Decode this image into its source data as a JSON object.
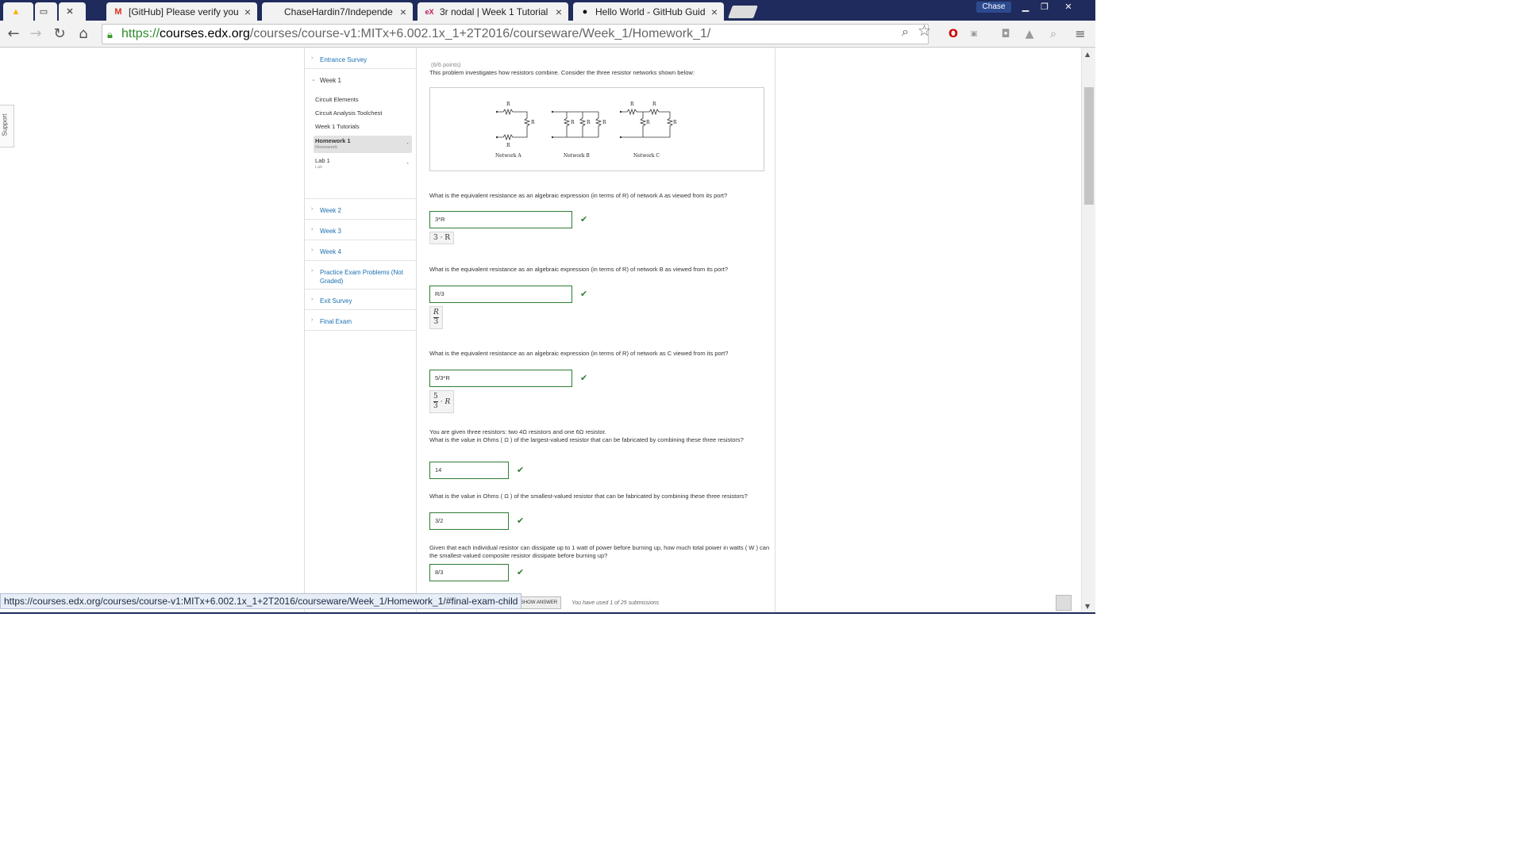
{
  "browser": {
    "tabs": [
      {
        "title": "",
        "favicon": "google-drive-icon"
      },
      {
        "title": "",
        "favicon": "document-icon"
      },
      {
        "title": "",
        "favicon": "close-icon"
      },
      {
        "title": "[GitHub] Please verify you",
        "favicon": "gmail-icon"
      },
      {
        "title": "ChaseHardin7/Independe",
        "favicon": "blank-page-icon"
      },
      {
        "title": "3r nodal | Week 1 Tutorial",
        "favicon": "edx-icon"
      },
      {
        "title": "Hello World - GitHub Guid",
        "favicon": "github-icon"
      }
    ],
    "user_name": "Chase",
    "url": {
      "scheme": "https://",
      "host": "courses.edx.org",
      "path": "/courses/course-v1:MITx+6.002.1x_1+2T2016/courseware/Week_1/Homework_1/"
    },
    "status_link": "https://courses.edx.org/courses/course-v1:MITx+6.002.1x_1+2T2016/courseware/Week_1/Homework_1/#final-exam-child"
  },
  "support_label": "Support",
  "sidebar": {
    "chapters": [
      {
        "title": "Entrance Survey"
      },
      {
        "title": "Week 1"
      },
      {
        "title": "Week 2"
      },
      {
        "title": "Week 3"
      },
      {
        "title": "Week 4"
      },
      {
        "title": "Practice Exam Problems (Not Graded)"
      },
      {
        "title": "Exit Survey"
      },
      {
        "title": "Final Exam"
      }
    ],
    "week1_sections": [
      {
        "title": "Circuit Elements",
        "sub": ""
      },
      {
        "title": "Circuit Analysis Toolchest",
        "sub": ""
      },
      {
        "title": "Week 1 Tutorials",
        "sub": ""
      },
      {
        "title": "Homework 1",
        "sub": "Homework"
      },
      {
        "title": "Lab 1",
        "sub": "Lab"
      }
    ]
  },
  "problem": {
    "points": "(6/6 points)",
    "intro": "This problem investigates how resistors combine. Consider the three resistor networks shown below:",
    "figure": {
      "resistor_label": "R",
      "captions": [
        "Network A",
        "Network B",
        "Network C"
      ]
    },
    "questions": [
      {
        "prompt": "What is the equivalent resistance as an algebraic expression (in terms of R) of network A as viewed from its port?",
        "answer": "3*R",
        "preview": "3 · R"
      },
      {
        "prompt": "What is the equivalent resistance as an algebraic expression (in terms of R) of network B as viewed from its port?",
        "answer": "R/3",
        "preview_num": "R",
        "preview_den": "3"
      },
      {
        "prompt": "What is the equivalent resistance as an algebraic expression (in terms of R) of network as C viewed from its port?",
        "answer": "5/3*R",
        "preview_num": "5",
        "preview_den": "3",
        "preview_tail": "· R"
      },
      {
        "prompt_1": "You are given three resistors: two 4Ω resistors and one 6Ω resistor.",
        "prompt": "What is the value in Ohms ( Ω ) of the largest-valued resistor that can be fabricated by combining these three resistors?",
        "answer": "14"
      },
      {
        "prompt": "What is the value in Ohms ( Ω ) of the smallest-valued resistor that can be fabricated by combining these three resistors?",
        "answer": "3/2"
      },
      {
        "prompt": "Given that each individual resistor can dissipate up to 1 watt of power before burning up, how much total power in watts ( W ) can the smallest-valued composite resistor dissipate before burning up?",
        "answer": "8/3"
      }
    ],
    "show_answer_label": "SHOW ANSWER",
    "submissions": "You have used 1 of 25 submissions"
  },
  "colors": {
    "link": "#1a6fb0",
    "correct": "#2e7d32",
    "titlebar": "#1f2b5c"
  }
}
